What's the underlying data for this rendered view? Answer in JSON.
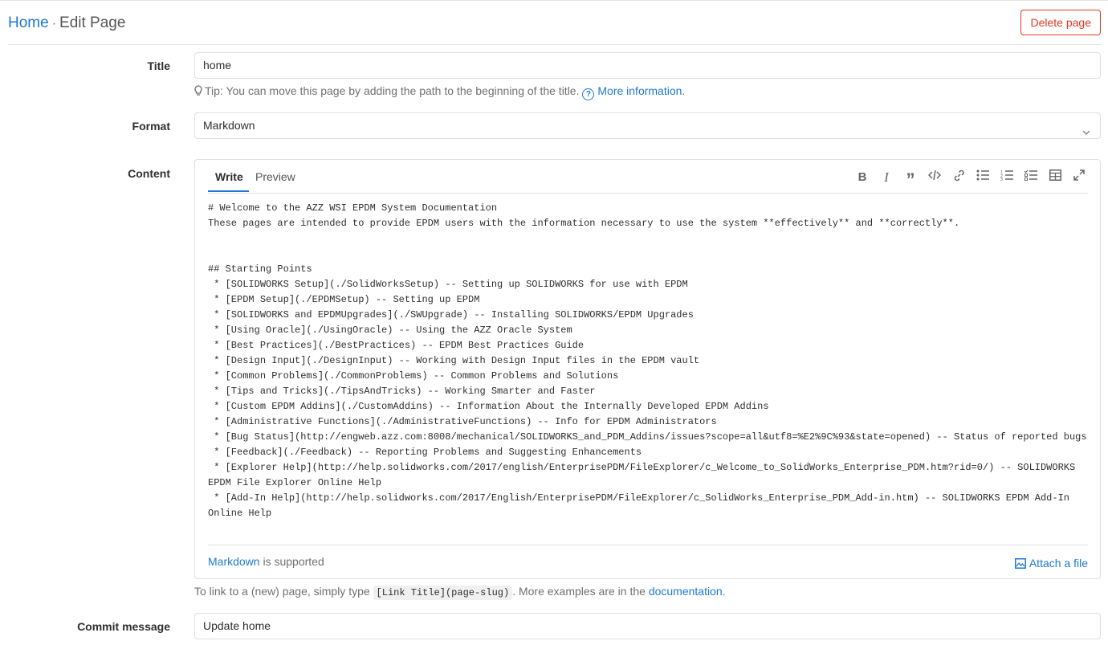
{
  "header": {
    "breadcrumb_home": "Home",
    "breadcrumb_separator": "·",
    "breadcrumb_current": "Edit Page",
    "delete_label": "Delete page"
  },
  "form": {
    "title_label": "Title",
    "title_value": "home",
    "title_tip": "Tip: You can move this page by adding the path to the beginning of the title.",
    "title_more_info": "More information",
    "title_more_info_suffix": ".",
    "format_label": "Format",
    "format_value": "Markdown",
    "content_label": "Content",
    "commit_label": "Commit message",
    "commit_value": "Update home"
  },
  "editor": {
    "tab_write": "Write",
    "tab_preview": "Preview",
    "toolbar_icons": [
      "bold-icon",
      "italic-icon",
      "quote-icon",
      "code-icon",
      "link-icon",
      "bullet-list-icon",
      "numbered-list-icon",
      "task-list-icon",
      "table-icon",
      "fullscreen-icon"
    ],
    "content": "# Welcome to the AZZ WSI EPDM System Documentation\nThese pages are intended to provide EPDM users with the information necessary to use the system **effectively** and **correctly**.\n\n\n## Starting Points\n * [SOLIDWORKS Setup](./SolidWorksSetup) -- Setting up SOLIDWORKS for use with EPDM\n * [EPDM Setup](./EPDMSetup) -- Setting up EPDM\n * [SOLIDWORKS and EPDMUpgrades](./SWUpgrade) -- Installing SOLIDWORKS/EPDM Upgrades\n * [Using Oracle](./UsingOracle) -- Using the AZZ Oracle System\n * [Best Practices](./BestPractices) -- EPDM Best Practices Guide\n * [Design Input](./DesignInput) -- Working with Design Input files in the EPDM vault\n * [Common Problems](./CommonProblems) -- Common Problems and Solutions\n * [Tips and Tricks](./TipsAndTricks) -- Working Smarter and Faster\n * [Custom EPDM Addins](./CustomAddins) -- Information About the Internally Developed EPDM Addins\n * [Administrative Functions](./AdministrativeFunctions) -- Info for EPDM Administrators\n * [Bug Status](http://engweb.azz.com:8008/mechanical/SOLIDWORKS_and_PDM_Addins/issues?scope=all&utf8=%E2%9C%93&state=opened) -- Status of reported bugs\n * [Feedback](./Feedback) -- Reporting Problems and Suggesting Enhancements\n * [Explorer Help](http://help.solidworks.com/2017/english/EnterprisePDM/FileExplorer/c_Welcome_to_SolidWorks_Enterprise_PDM.htm?rid=0/) -- SOLIDWORKS EPDM File Explorer Online Help\n * [Add-In Help](http://help.solidworks.com/2017/English/EnterprisePDM/FileExplorer/c_SolidWorks_Enterprise_PDM_Add-in.htm) -- SOLIDWORKS EPDM Add-In Online Help",
    "markdown_link": "Markdown",
    "markdown_suffix": " is supported",
    "attach_label": "Attach a file"
  },
  "link_hint": {
    "prefix": "To link to a (new) page, simply type ",
    "code": "[Link Title](page-slug)",
    "middle": ". More examples are in the ",
    "doc_link": "documentation",
    "suffix": "."
  },
  "colors": {
    "link": "#1f78d1",
    "danger": "#db3b21",
    "border": "#dfdfdf"
  }
}
